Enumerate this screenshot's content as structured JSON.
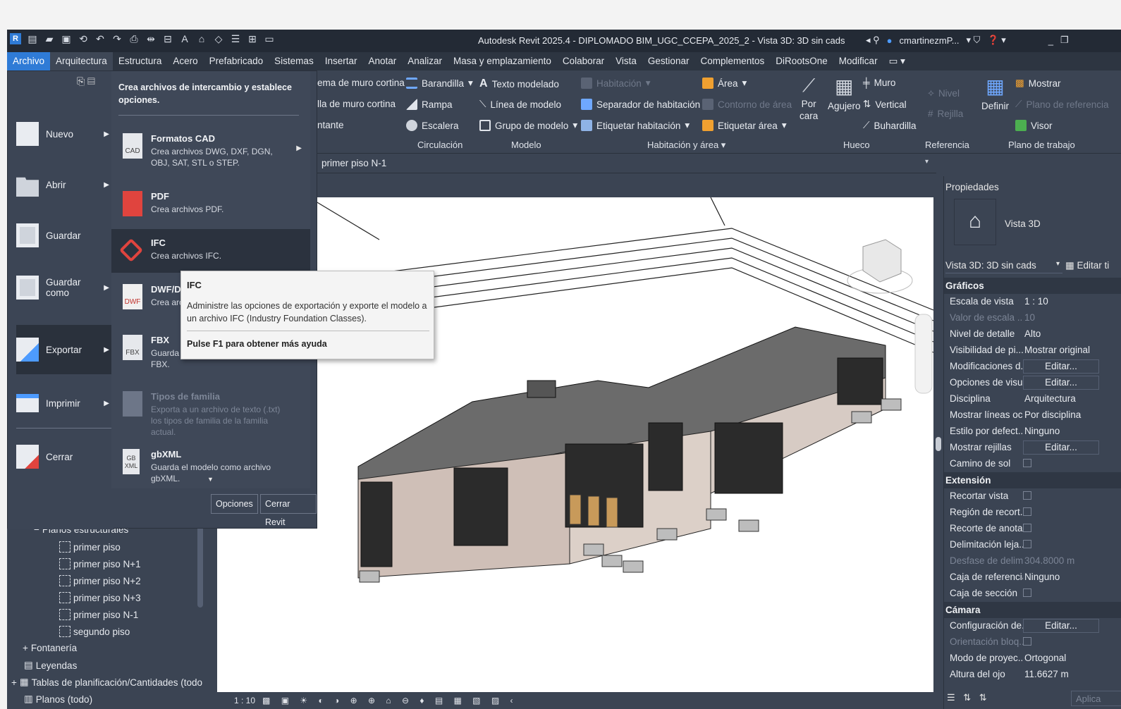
{
  "title_bar": {
    "title": "Autodesk Revit 2025.4 - DIPLOMADO BIM_UGC_CCEPA_2025_2 - Vista 3D: 3D sin cads",
    "user": "cmartinezmP...",
    "window_controls": [
      "_",
      "❐"
    ]
  },
  "menu": {
    "tabs": [
      "Archivo",
      "Arquitectura",
      "Estructura",
      "Acero",
      "Prefabricado",
      "Sistemas",
      "Insertar",
      "Anotar",
      "Analizar",
      "Masa y emplazamiento",
      "Colaborar",
      "Vista",
      "Gestionar",
      "Complementos",
      "DiRootsOne",
      "Modificar"
    ]
  },
  "ribbon": {
    "partial1": "ema de muro cortina",
    "partial2": "lla de muro cortina",
    "partial3": "ntante",
    "barandilla": "Barandilla",
    "rampa": "Rampa",
    "escalera": "Escalera",
    "group_circulacion": "Circulación",
    "texto_modelado": "Texto modelado",
    "linea_modelo": "Línea de modelo",
    "grupo_modelo": "Grupo de modelo",
    "group_modelo": "Modelo",
    "habitacion": "Habitación",
    "separador": "Separador  de habitación",
    "etiquetar_hab": "Etiquetar  habitación",
    "area": "Área",
    "contorno_area": "Contorno  de área",
    "etiquetar_area": "Etiquetar  área",
    "group_habitacion": "Habitación y área",
    "por_cara_1": "Por",
    "por_cara_2": "cara",
    "agujero": "Agujero",
    "muro": "Muro",
    "vertical": "Vertical",
    "buhardilla": "Buhardilla",
    "group_hueco": "Hueco",
    "nivel": "Nivel",
    "rejilla": "Rejilla",
    "group_referencia": "Referencia",
    "definir": "Definir",
    "mostrar": "Mostrar",
    "plano_ref": "Plano de referencia",
    "visor": "Visor",
    "group_plano": "Plano de trabajo"
  },
  "doc_tab": "primer piso N-1",
  "file_menu": {
    "header": "Crea archivos de intercambio y establece opciones.",
    "left_items": [
      {
        "label": "Nuevo"
      },
      {
        "label": "Abrir"
      },
      {
        "label": "Guardar"
      },
      {
        "label": "Guardar como"
      },
      {
        "label": "Exportar"
      },
      {
        "label": "Imprimir"
      },
      {
        "label": "Cerrar"
      }
    ],
    "export_items": [
      {
        "title": "Formatos CAD",
        "desc": "Crea archivos DWG, DXF, DGN, OBJ, SAT, STL o STEP.",
        "icon": "CAD"
      },
      {
        "title": "PDF",
        "desc": "Crea archivos PDF."
      },
      {
        "title": "IFC",
        "desc": "Crea archivos IFC."
      },
      {
        "title": "DWF/DWFx",
        "desc": "Crea archivos DWF o DWFx.",
        "icon": "DWF"
      },
      {
        "title": "FBX",
        "desc": "Guarda una vista 3D como archivo FBX.",
        "icon": "FBX"
      },
      {
        "title": "Tipos de familia",
        "desc": "Exporta a un archivo de texto (.txt) los tipos de familia de la familia actual."
      },
      {
        "title": "gbXML",
        "desc": "Guarda el modelo como archivo gbXML.",
        "icon": "GB XML"
      }
    ],
    "opciones": "Opciones",
    "cerrar_revit": "Cerrar Revit"
  },
  "tooltip": {
    "title": "IFC",
    "body": "Administre las opciones de exportación y exporte el modelo a un archivo IFC (Industry Foundation Classes).",
    "help": "Pulse F1 para obtener más ayuda"
  },
  "browser": {
    "items": [
      {
        "label": "Planos estructurales",
        "level": 1,
        "toggle": "−"
      },
      {
        "label": "primer piso",
        "level": 2
      },
      {
        "label": "primer piso N+1",
        "level": 2
      },
      {
        "label": "primer piso N+2",
        "level": 2
      },
      {
        "label": "primer piso N+3",
        "level": 2
      },
      {
        "label": "primer piso N-1",
        "level": 2
      },
      {
        "label": "segundo piso",
        "level": 2
      },
      {
        "label": "Fontanería",
        "level": 1,
        "toggle": "+"
      },
      {
        "label": "Leyendas",
        "level": 0
      },
      {
        "label": "Tablas de planificación/Cantidades (todo",
        "level": 0,
        "toggle": "+"
      },
      {
        "label": "Planos (todo)",
        "level": 0
      }
    ]
  },
  "view_bar": {
    "scale": "1 : 10"
  },
  "properties": {
    "title": "Propiedades",
    "type_name": "Vista 3D",
    "selector": "Vista 3D: 3D sin cads",
    "edit_type": "Editar ti",
    "apply": "Aplica",
    "sections": [
      {
        "name": "Gráficos",
        "rows": [
          {
            "k": "Escala de vista",
            "v": "1 : 10"
          },
          {
            "k": "Valor de escala ...",
            "v": "10",
            "dim": true
          },
          {
            "k": "Nivel de detalle",
            "v": "Alto"
          },
          {
            "k": "Visibilidad de pi...",
            "v": "Mostrar original"
          },
          {
            "k": "Modificaciones d...",
            "btn": "Editar..."
          },
          {
            "k": "Opciones de visu...",
            "btn": "Editar..."
          },
          {
            "k": "Disciplina",
            "v": "Arquitectura"
          },
          {
            "k": "Mostrar líneas oc...",
            "v": "Por disciplina"
          },
          {
            "k": "Estilo por defect...",
            "v": "Ninguno"
          },
          {
            "k": "Mostrar rejillas",
            "btn": "Editar..."
          },
          {
            "k": "Camino de sol",
            "chk": true
          }
        ]
      },
      {
        "name": "Extensión",
        "rows": [
          {
            "k": "Recortar vista",
            "chk": true
          },
          {
            "k": "Región de recort...",
            "chk": true
          },
          {
            "k": "Recorte de anota...",
            "chk": true
          },
          {
            "k": "Delimitación leja...",
            "chk": true
          },
          {
            "k": "Desfase de delim...",
            "v": "304.8000 m",
            "dim": true
          },
          {
            "k": "Caja de referencia",
            "v": "Ninguno"
          },
          {
            "k": "Caja de sección",
            "chk": true
          }
        ]
      },
      {
        "name": "Cámara",
        "rows": [
          {
            "k": "Configuración de...",
            "btn": "Editar..."
          },
          {
            "k": "Orientación bloq...",
            "chk": true,
            "dim": true
          },
          {
            "k": "Modo de proyec...",
            "v": "Ortogonal"
          },
          {
            "k": "Altura del ojo",
            "v": "11.6627 m"
          }
        ]
      }
    ]
  }
}
